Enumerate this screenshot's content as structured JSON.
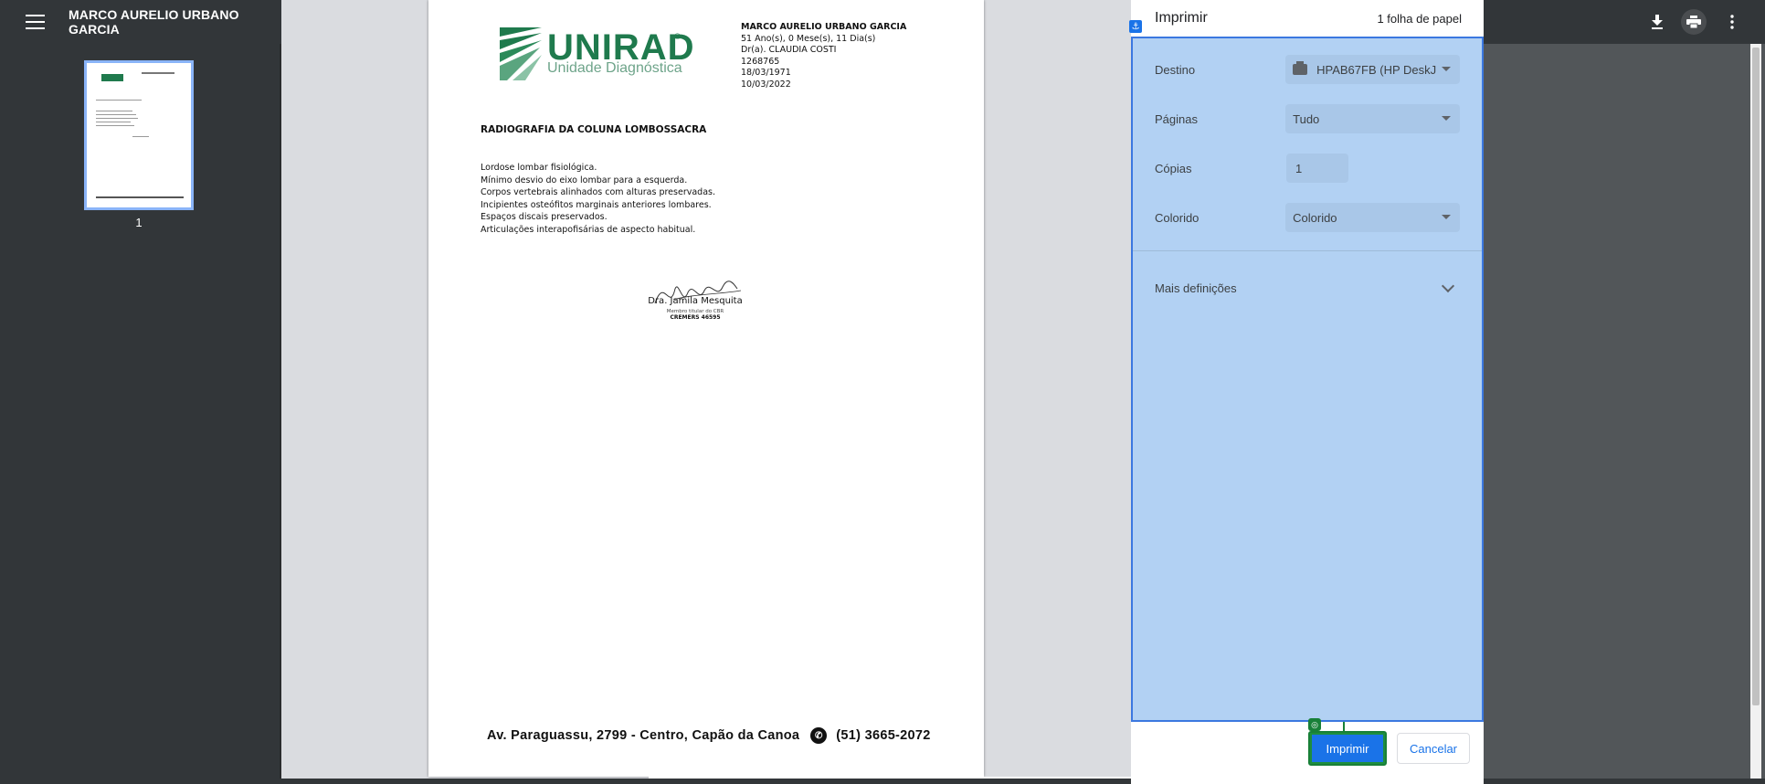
{
  "viewer": {
    "doc_title": "MARCO AURELIO URBANO GARCIA",
    "page_number": "1",
    "toolbar_icons": [
      "menu-icon",
      "download-icon",
      "print-icon",
      "more-vert-icon"
    ]
  },
  "document": {
    "logo": {
      "name": "UNIRAD",
      "tagline": "Unidade Diagnóstica"
    },
    "patient": {
      "name": "MARCO AURELIO URBANO GARCIA",
      "age": "51 Ano(s), 0 Mese(s), 11 Dia(s)",
      "doctor": "Dr(a). CLAUDIA COSTI",
      "id": "1268765",
      "birth_date": "18/03/1971",
      "exam_date": "10/03/2022"
    },
    "exam_title": "RADIOGRAFIA DA COLUNA LOMBOSSACRA",
    "findings": [
      "Lordose lombar fisiológica.",
      "Mínimo desvio do eixo lombar para a esquerda.",
      "Corpos vertebrais alinhados com alturas preservadas.",
      "Incipientes osteófitos marginais anteriores lombares.",
      "Espaços discais preservados.",
      "Articulações interapofisárias de aspecto habitual."
    ],
    "signature": {
      "name": "Dra. Jamila Mesquita",
      "subtitle": "Membro titular do CBR",
      "crm": "CREMERS 46595"
    },
    "footer": {
      "address": "Av. Paraguassu, 2799 - Centro, Capão da Canoa",
      "phone": "(51) 3665-2072"
    }
  },
  "print_dialog": {
    "title": "Imprimir",
    "sheets": "1 folha de papel",
    "destination": {
      "label": "Destino",
      "value": "HPAB67FB (HP DeskJ"
    },
    "pages": {
      "label": "Páginas",
      "value": "Tudo"
    },
    "copies": {
      "label": "Cópias",
      "value": "1"
    },
    "color": {
      "label": "Colorido",
      "value": "Colorido"
    },
    "more_settings": "Mais definições",
    "print_button": "Imprimir",
    "cancel_button": "Cancelar"
  },
  "colors": {
    "brand_green": "#1f7a4d",
    "accent_blue": "#1a73e8",
    "highlight": "#b2d1f3",
    "viewer_dark": "#323639"
  }
}
